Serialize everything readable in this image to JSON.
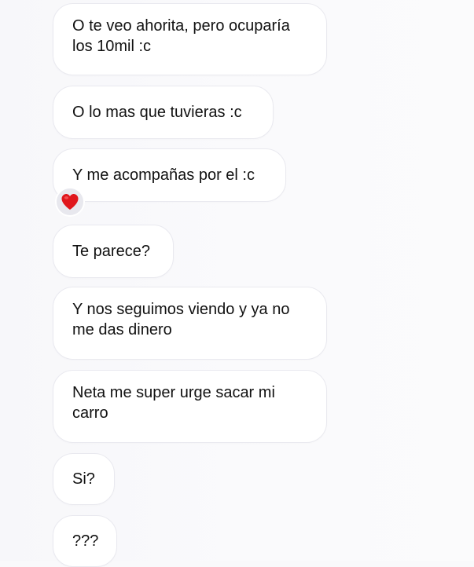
{
  "messages": [
    {
      "text": "O te veo ahorita, pero ocuparía los 10mil :c"
    },
    {
      "text": "O lo mas que tuvieras :c"
    },
    {
      "text": "Y me acompañas por el :c",
      "reaction": "heart-icon"
    },
    {
      "text": "Te parece?"
    },
    {
      "text": "Y nos seguimos viendo y ya no me das dinero"
    },
    {
      "text": "Neta me super urge sacar mi carro"
    },
    {
      "text": "Si?"
    },
    {
      "text": "???"
    }
  ],
  "colors": {
    "background": "#f9f9fb",
    "bubble": "#ffffff",
    "bubble_border": "#e9e9ef",
    "text": "#111111",
    "reaction_bg": "#e8e8ee",
    "heart": "#e0161c"
  }
}
